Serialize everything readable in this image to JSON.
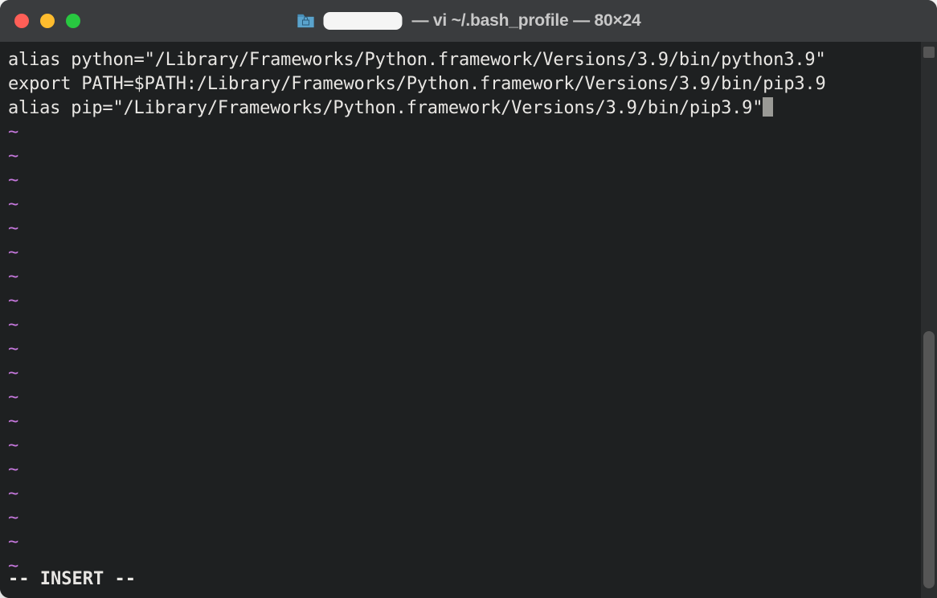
{
  "window": {
    "title_suffix": "— vi ~/.bash_profile — 80×24"
  },
  "editor": {
    "lines": [
      "alias python=\"/Library/Frameworks/Python.framework/Versions/3.9/bin/python3.9\"",
      "export PATH=$PATH:/Library/Frameworks/Python.framework/Versions/3.9/bin/pip3.9",
      "alias pip=\"/Library/Frameworks/Python.framework/Versions/3.9/bin/pip3.9\""
    ],
    "tilde": "~",
    "tilde_count": 19,
    "status": "-- INSERT --"
  }
}
